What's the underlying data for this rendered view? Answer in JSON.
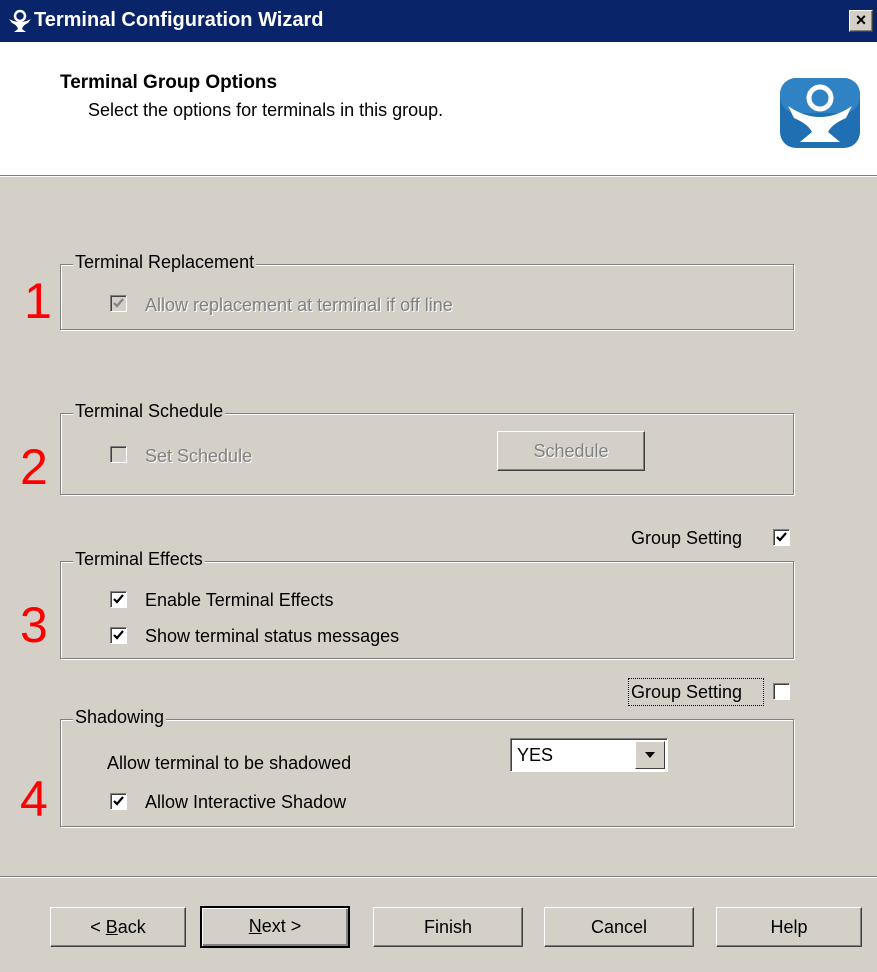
{
  "window": {
    "title": "Terminal Configuration Wizard",
    "close_label": "×"
  },
  "header": {
    "title": "Terminal Group Options",
    "subtitle": "Select the options for terminals in this group."
  },
  "sections": {
    "replacement": {
      "number": "1",
      "legend": "Terminal Replacement",
      "option_label": "Allow replacement at terminal if off line",
      "option_checked": true,
      "enabled": false
    },
    "schedule": {
      "number": "2",
      "legend": "Terminal Schedule",
      "option_label": "Set Schedule",
      "option_checked": false,
      "button_label": "Schedule",
      "enabled": false
    },
    "effects": {
      "number": "3",
      "group_setting_label": "Group Setting",
      "group_setting_checked": true,
      "legend": "Terminal Effects",
      "enable_label": "Enable Terminal Effects",
      "enable_checked": true,
      "status_label": "Show terminal status messages",
      "status_checked": true
    },
    "shadowing": {
      "number": "4",
      "group_setting_label": "Group Setting",
      "group_setting_checked": false,
      "legend": "Shadowing",
      "allow_label": "Allow terminal to be shadowed",
      "allow_value": "YES",
      "interactive_label": "Allow Interactive Shadow",
      "interactive_checked": true
    }
  },
  "buttons": {
    "back": {
      "prefix": "< ",
      "mnemonic": "B",
      "rest": "ack"
    },
    "next": {
      "mnemonic": "N",
      "rest": "ext >"
    },
    "finish": "Finish",
    "cancel": "Cancel",
    "help": "Help"
  },
  "colors": {
    "titlebar": "#0a246a",
    "dialog_bg": "#d4d0c8",
    "annotation_red": "#ff0000",
    "logo_blue": "#1f6fb2"
  },
  "icons": {
    "title": "thinmanager-icon",
    "logo": "thinmanager-logo",
    "dropdown": "chevron-down-icon"
  }
}
